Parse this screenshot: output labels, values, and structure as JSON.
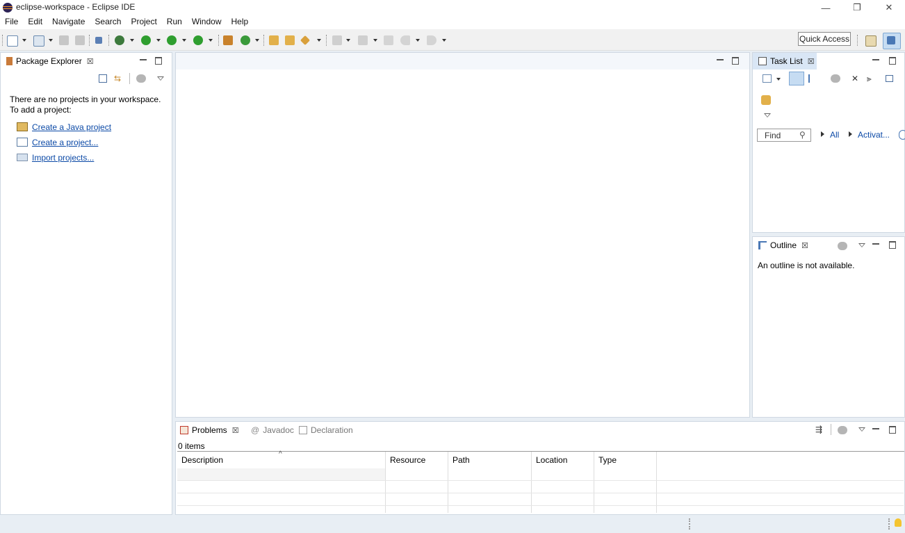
{
  "window": {
    "title": "eclipse-workspace - Eclipse IDE",
    "minimize_glyph": "—",
    "restore_glyph": "❐",
    "close_glyph": "✕"
  },
  "menu": [
    "File",
    "Edit",
    "Navigate",
    "Search",
    "Project",
    "Run",
    "Window",
    "Help"
  ],
  "toolbar": {
    "quick_access_label": "Quick Access"
  },
  "package_explorer": {
    "tab_label": "Package Explorer",
    "empty_message_line1": "There are no projects in your workspace.",
    "empty_message_line2": "To add a project:",
    "links": {
      "create_java_project": "Create a Java project",
      "create_project": "Create a project...",
      "import_projects": "Import projects..."
    }
  },
  "task_list": {
    "tab_label": "Task List",
    "find_placeholder": "Find",
    "filter_all": "All",
    "filter_activate": "Activat..."
  },
  "outline": {
    "tab_label": "Outline",
    "message": "An outline is not available."
  },
  "bottom_panel": {
    "tabs": {
      "problems": "Problems",
      "javadoc": "Javadoc",
      "declaration": "Declaration"
    },
    "item_count": "0 items",
    "columns": {
      "description": "Description",
      "resource": "Resource",
      "path": "Path",
      "location": "Location",
      "type": "Type"
    }
  },
  "colors": {
    "accent": "#0b49a6",
    "selected_tab": "#d9e6f5",
    "brand": "#2c2255"
  },
  "icons": [
    "eclipse-logo-icon",
    "new-icon",
    "save-icon",
    "debug-icon",
    "run-icon",
    "search-icon",
    "back-icon",
    "forward-icon",
    "lightbulb-icon"
  ]
}
